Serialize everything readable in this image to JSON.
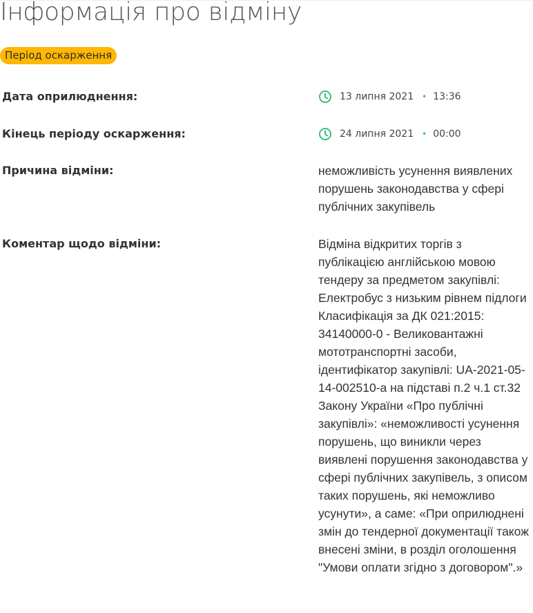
{
  "page": {
    "title": "Інформація про відміну"
  },
  "status": {
    "label": "Період оскарження",
    "color": "#ffb703"
  },
  "rows": {
    "published": {
      "label": "Дата оприлюднення:",
      "icon": "clock-icon",
      "date": "13 липня 2021",
      "separator": "•",
      "time": "13:36"
    },
    "complaint_end": {
      "label": "Кінець періоду оскарження:",
      "icon": "clock-icon",
      "date": "24 липня 2021",
      "separator": "•",
      "time": "00:00"
    },
    "reason": {
      "label": "Причина відміни:",
      "value": "неможливість усунення виявлених порушень законодавства у сфері публічних закупівель"
    },
    "comment": {
      "label": "Коментар щодо відміни:",
      "value": "Відміна відкритих торгів з публікацією англійською мовою тендеру за предметом закупівлі: Електробус з низьким рівнем підлоги Класифікація за ДК 021:2015: 34140000-0 - Великовантажні мототранспортні засоби, ідентифікатор закупівлі: UA-2021-05-14-002510-a на підставі п.2 ч.1 ст.32 Закону України «Про публічні закупівлі»: «неможливості усунення порушень, що виникли через виявлені порушення законодавства у сфері публічних закупівель, з описом таких порушень, які неможливо усунути», а саме: «При оприлюднені змін до тендерної документації також внесені зміни, в розділ оголошення \"Умови оплати згідно з договором\".»"
    }
  },
  "colors": {
    "accent_green": "#3bbf7f",
    "text": "#333333"
  }
}
